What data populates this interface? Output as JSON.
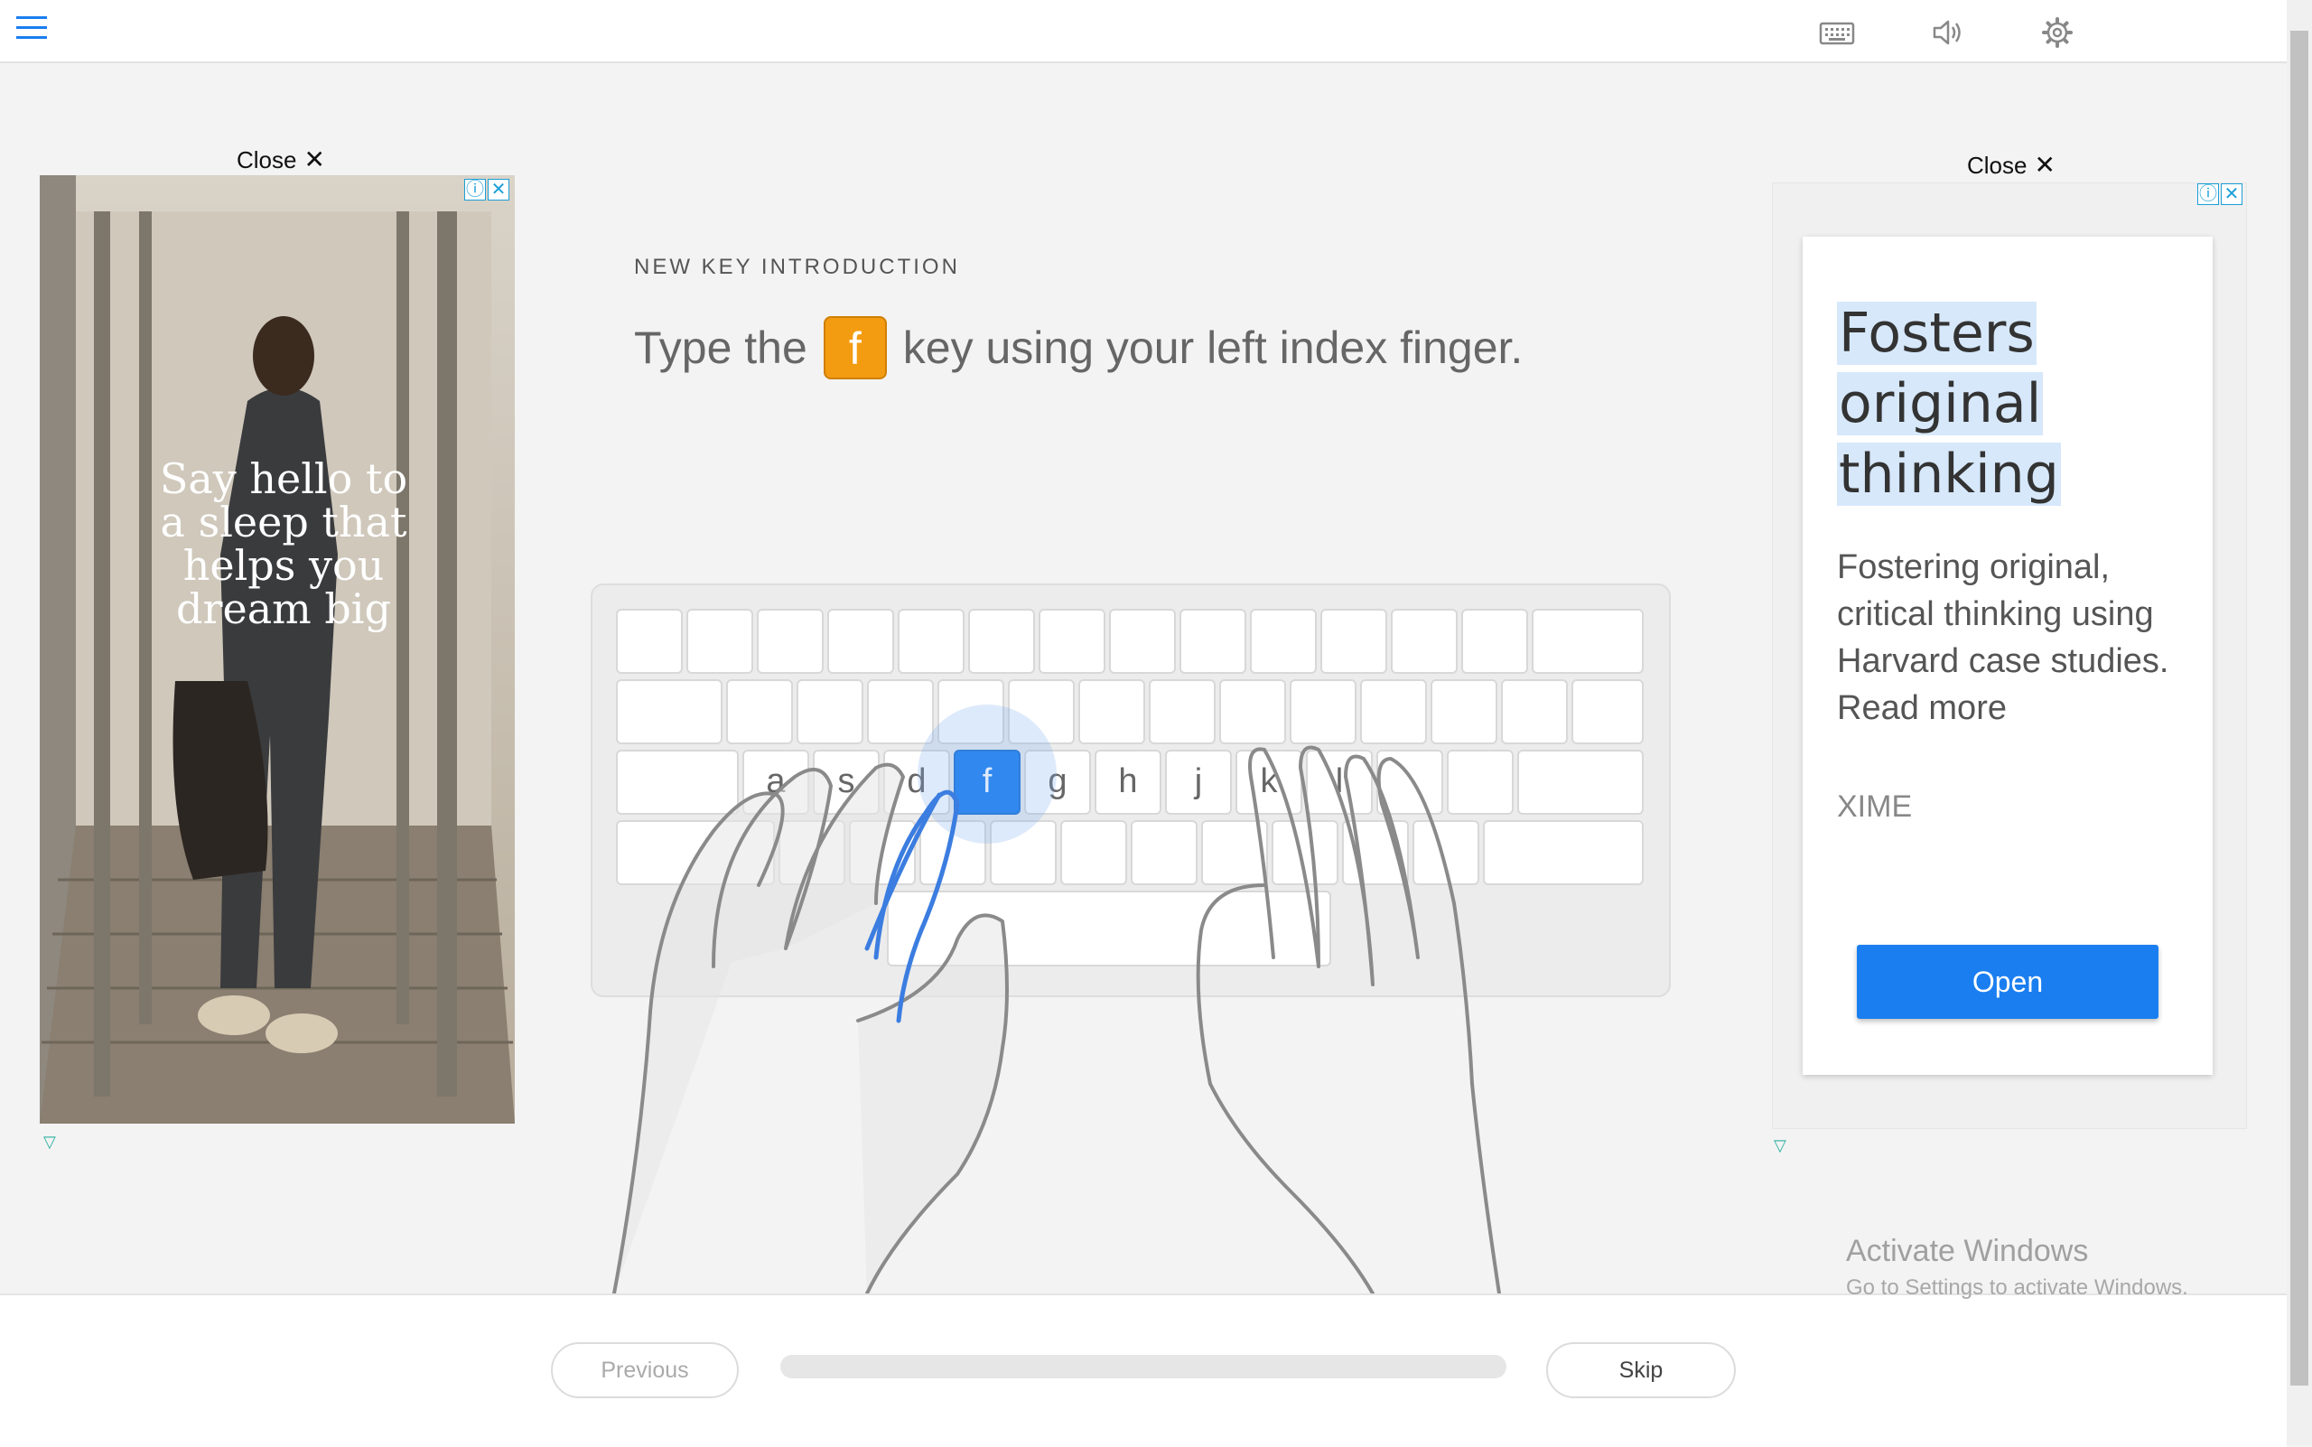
{
  "header": {
    "icons": [
      "menu-icon",
      "keyboard-icon",
      "speaker-icon",
      "gear-icon"
    ]
  },
  "ads": {
    "left": {
      "close_label": "Close",
      "close_symbol": "✕",
      "text": "Say hello to\na sleep that\nhelps you\ndream big"
    },
    "right": {
      "close_label": "Close",
      "close_symbol": "✕",
      "headline_line1": "Fosters",
      "headline_line2": "original",
      "headline_line3": "thinking",
      "body": "Fostering original, critical thinking using Harvard case studies. Read more",
      "brand": "XIME",
      "open_label": "Open"
    }
  },
  "lesson": {
    "label": "NEW KEY INTRODUCTION",
    "instruction_before": "Type the",
    "key": "f",
    "instruction_after": "key using your left index finger.",
    "home_row_keys": [
      "a",
      "s",
      "d",
      "f",
      "g",
      "h",
      "j",
      "k",
      "l"
    ],
    "active_key": "f"
  },
  "footer": {
    "previous_label": "Previous",
    "skip_label": "Skip",
    "progress": 0
  },
  "watermark": {
    "title": "Activate Windows",
    "subtitle": "Go to Settings to activate Windows."
  },
  "colors": {
    "accent": "#1a7ef0",
    "key_highlight": "#f39c12",
    "hand_outline": "#8a8a8a"
  }
}
